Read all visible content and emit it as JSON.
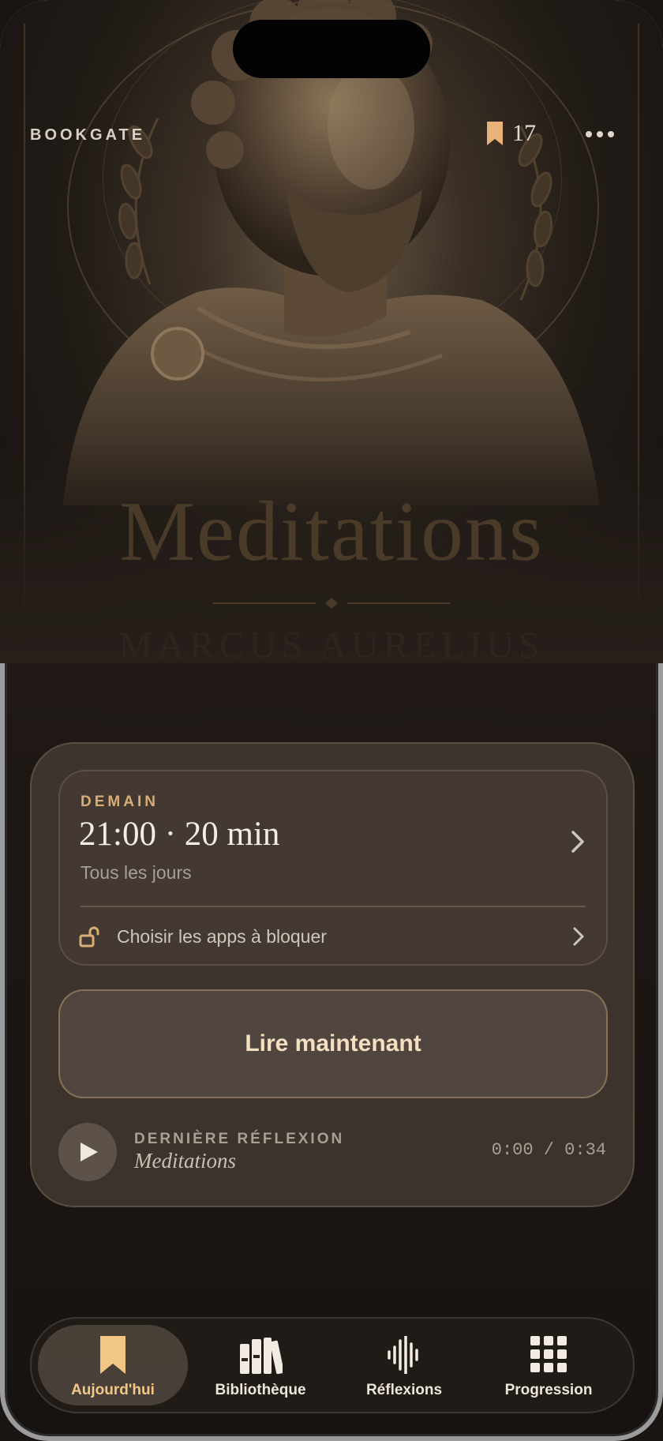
{
  "header": {
    "brand": "BOOKGATE",
    "bookmark_count": "17"
  },
  "hero": {
    "title": "Meditations",
    "author": "Marcus Aurelius"
  },
  "schedule": {
    "eyebrow": "DEMAIN",
    "time": "21:00 · 20 min",
    "frequency": "Tous les jours",
    "apps_label": "Choisir les apps à bloquer"
  },
  "cta_label": "Lire maintenant",
  "player": {
    "label": "DERNIÈRE RÉFLEXION",
    "title": "Meditations",
    "time": "0:00 / 0:34"
  },
  "tabs": [
    {
      "label": "Aujourd'hui",
      "icon": "bookmark-icon",
      "active": true
    },
    {
      "label": "Bibliothèque",
      "icon": "books-icon",
      "active": false
    },
    {
      "label": "Réflexions",
      "icon": "waveform-icon",
      "active": false
    },
    {
      "label": "Progression",
      "icon": "grid-icon",
      "active": false
    }
  ],
  "colors": {
    "accent": "#f2c786",
    "eyebrow": "#d9ad75",
    "bookmark": "#e8b278"
  }
}
